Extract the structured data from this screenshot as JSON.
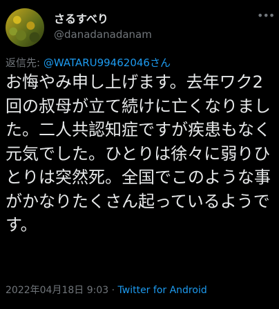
{
  "user": {
    "display_name": "さるすべり",
    "handle": "@danadanadanam"
  },
  "header": {
    "more_icon": "more-dots-icon",
    "more_label": "•••"
  },
  "reply": {
    "prefix": "返信先: ",
    "mention": "@WATARU99462046さん"
  },
  "tweet": {
    "text": "お悔やみ申し上げます。去年ワク2回の叔母が立て続けに亡くなりました。二人共認知症ですが疾患もなく元気でした。ひとりは徐々に弱りひとりは突然死。全国でこのような事がかなりたくさん起っているようです。"
  },
  "meta": {
    "timestamp": "2022年04月18日 9:03",
    "separator": " · ",
    "source": "Twitter for Android"
  },
  "colors": {
    "background": "#000000",
    "text": "#e7e9ea",
    "secondary": "#71767b",
    "link": "#1d9bf0"
  }
}
